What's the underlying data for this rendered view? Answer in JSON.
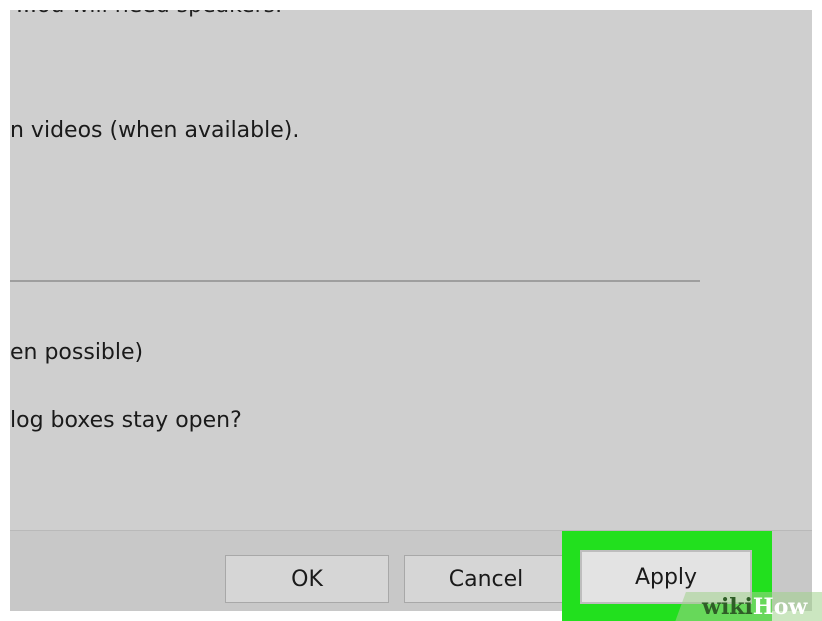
{
  "dialog": {
    "lines": {
      "top_partial": "...ou will need speakers.",
      "captions": "n videos (when available).",
      "possible": "en possible)",
      "dialog_boxes": "log boxes stay open?"
    }
  },
  "footer": {
    "ok_label": "OK",
    "cancel_label": "Cancel",
    "apply_label": "Apply"
  },
  "watermark": {
    "wiki": "wiki",
    "how": "How"
  },
  "colors": {
    "dialog_bg": "#cfcfcf",
    "highlight": "#22e01e"
  }
}
